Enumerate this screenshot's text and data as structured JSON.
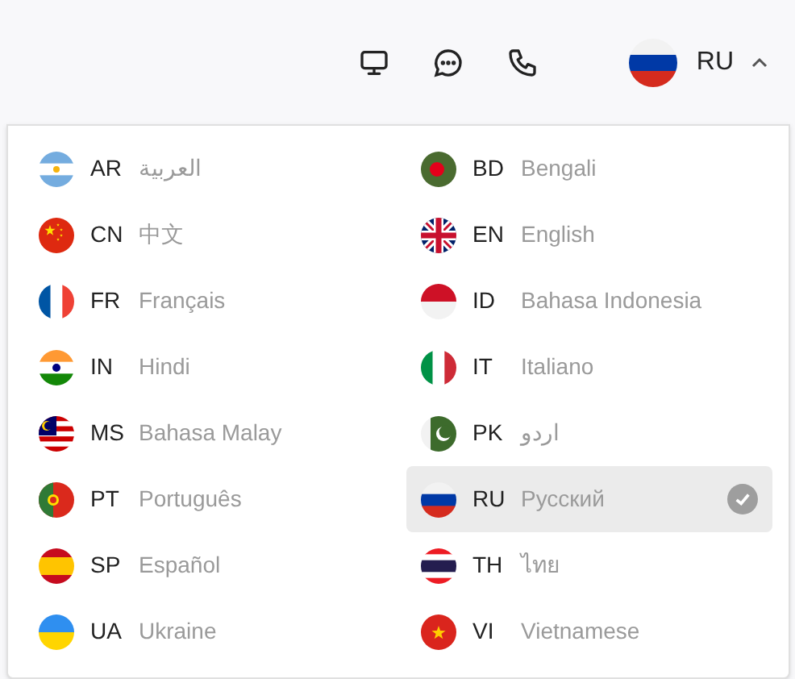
{
  "header": {
    "language_button": {
      "code": "RU",
      "expanded": true
    }
  },
  "languages": [
    {
      "code": "AR",
      "name": "العربية",
      "selected": false
    },
    {
      "code": "BD",
      "name": "Bengali",
      "selected": false
    },
    {
      "code": "CN",
      "name": "中文",
      "selected": false
    },
    {
      "code": "EN",
      "name": "English",
      "selected": false
    },
    {
      "code": "FR",
      "name": "Français",
      "selected": false
    },
    {
      "code": "ID",
      "name": "Bahasa Indonesia",
      "selected": false
    },
    {
      "code": "IN",
      "name": "Hindi",
      "selected": false
    },
    {
      "code": "IT",
      "name": "Italiano",
      "selected": false
    },
    {
      "code": "MS",
      "name": "Bahasa Malay",
      "selected": false
    },
    {
      "code": "PK",
      "name": "اردو",
      "selected": false
    },
    {
      "code": "PT",
      "name": "Português",
      "selected": false
    },
    {
      "code": "RU",
      "name": "Русский",
      "selected": true
    },
    {
      "code": "SP",
      "name": "Español",
      "selected": false
    },
    {
      "code": "TH",
      "name": "ไทย",
      "selected": false
    },
    {
      "code": "UA",
      "name": "Ukraine",
      "selected": false
    },
    {
      "code": "VI",
      "name": "Vietnamese",
      "selected": false
    }
  ]
}
